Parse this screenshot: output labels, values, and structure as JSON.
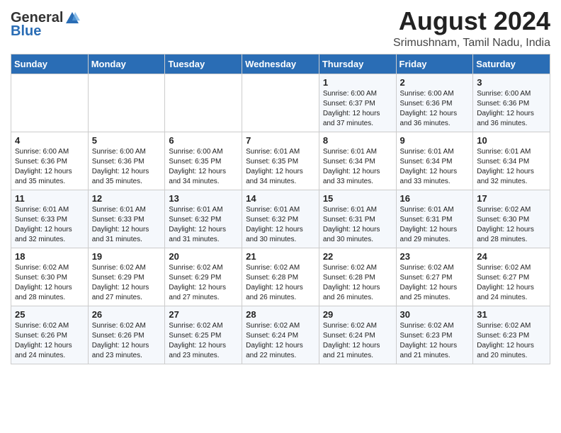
{
  "header": {
    "logo_general": "General",
    "logo_blue": "Blue",
    "month": "August 2024",
    "location": "Srimushnam, Tamil Nadu, India"
  },
  "weekdays": [
    "Sunday",
    "Monday",
    "Tuesday",
    "Wednesday",
    "Thursday",
    "Friday",
    "Saturday"
  ],
  "weeks": [
    [
      {
        "day": "",
        "info": ""
      },
      {
        "day": "",
        "info": ""
      },
      {
        "day": "",
        "info": ""
      },
      {
        "day": "",
        "info": ""
      },
      {
        "day": "1",
        "info": "Sunrise: 6:00 AM\nSunset: 6:37 PM\nDaylight: 12 hours\nand 37 minutes."
      },
      {
        "day": "2",
        "info": "Sunrise: 6:00 AM\nSunset: 6:36 PM\nDaylight: 12 hours\nand 36 minutes."
      },
      {
        "day": "3",
        "info": "Sunrise: 6:00 AM\nSunset: 6:36 PM\nDaylight: 12 hours\nand 36 minutes."
      }
    ],
    [
      {
        "day": "4",
        "info": "Sunrise: 6:00 AM\nSunset: 6:36 PM\nDaylight: 12 hours\nand 35 minutes."
      },
      {
        "day": "5",
        "info": "Sunrise: 6:00 AM\nSunset: 6:36 PM\nDaylight: 12 hours\nand 35 minutes."
      },
      {
        "day": "6",
        "info": "Sunrise: 6:00 AM\nSunset: 6:35 PM\nDaylight: 12 hours\nand 34 minutes."
      },
      {
        "day": "7",
        "info": "Sunrise: 6:01 AM\nSunset: 6:35 PM\nDaylight: 12 hours\nand 34 minutes."
      },
      {
        "day": "8",
        "info": "Sunrise: 6:01 AM\nSunset: 6:34 PM\nDaylight: 12 hours\nand 33 minutes."
      },
      {
        "day": "9",
        "info": "Sunrise: 6:01 AM\nSunset: 6:34 PM\nDaylight: 12 hours\nand 33 minutes."
      },
      {
        "day": "10",
        "info": "Sunrise: 6:01 AM\nSunset: 6:34 PM\nDaylight: 12 hours\nand 32 minutes."
      }
    ],
    [
      {
        "day": "11",
        "info": "Sunrise: 6:01 AM\nSunset: 6:33 PM\nDaylight: 12 hours\nand 32 minutes."
      },
      {
        "day": "12",
        "info": "Sunrise: 6:01 AM\nSunset: 6:33 PM\nDaylight: 12 hours\nand 31 minutes."
      },
      {
        "day": "13",
        "info": "Sunrise: 6:01 AM\nSunset: 6:32 PM\nDaylight: 12 hours\nand 31 minutes."
      },
      {
        "day": "14",
        "info": "Sunrise: 6:01 AM\nSunset: 6:32 PM\nDaylight: 12 hours\nand 30 minutes."
      },
      {
        "day": "15",
        "info": "Sunrise: 6:01 AM\nSunset: 6:31 PM\nDaylight: 12 hours\nand 30 minutes."
      },
      {
        "day": "16",
        "info": "Sunrise: 6:01 AM\nSunset: 6:31 PM\nDaylight: 12 hours\nand 29 minutes."
      },
      {
        "day": "17",
        "info": "Sunrise: 6:02 AM\nSunset: 6:30 PM\nDaylight: 12 hours\nand 28 minutes."
      }
    ],
    [
      {
        "day": "18",
        "info": "Sunrise: 6:02 AM\nSunset: 6:30 PM\nDaylight: 12 hours\nand 28 minutes."
      },
      {
        "day": "19",
        "info": "Sunrise: 6:02 AM\nSunset: 6:29 PM\nDaylight: 12 hours\nand 27 minutes."
      },
      {
        "day": "20",
        "info": "Sunrise: 6:02 AM\nSunset: 6:29 PM\nDaylight: 12 hours\nand 27 minutes."
      },
      {
        "day": "21",
        "info": "Sunrise: 6:02 AM\nSunset: 6:28 PM\nDaylight: 12 hours\nand 26 minutes."
      },
      {
        "day": "22",
        "info": "Sunrise: 6:02 AM\nSunset: 6:28 PM\nDaylight: 12 hours\nand 26 minutes."
      },
      {
        "day": "23",
        "info": "Sunrise: 6:02 AM\nSunset: 6:27 PM\nDaylight: 12 hours\nand 25 minutes."
      },
      {
        "day": "24",
        "info": "Sunrise: 6:02 AM\nSunset: 6:27 PM\nDaylight: 12 hours\nand 24 minutes."
      }
    ],
    [
      {
        "day": "25",
        "info": "Sunrise: 6:02 AM\nSunset: 6:26 PM\nDaylight: 12 hours\nand 24 minutes."
      },
      {
        "day": "26",
        "info": "Sunrise: 6:02 AM\nSunset: 6:26 PM\nDaylight: 12 hours\nand 23 minutes."
      },
      {
        "day": "27",
        "info": "Sunrise: 6:02 AM\nSunset: 6:25 PM\nDaylight: 12 hours\nand 23 minutes."
      },
      {
        "day": "28",
        "info": "Sunrise: 6:02 AM\nSunset: 6:24 PM\nDaylight: 12 hours\nand 22 minutes."
      },
      {
        "day": "29",
        "info": "Sunrise: 6:02 AM\nSunset: 6:24 PM\nDaylight: 12 hours\nand 21 minutes."
      },
      {
        "day": "30",
        "info": "Sunrise: 6:02 AM\nSunset: 6:23 PM\nDaylight: 12 hours\nand 21 minutes."
      },
      {
        "day": "31",
        "info": "Sunrise: 6:02 AM\nSunset: 6:23 PM\nDaylight: 12 hours\nand 20 minutes."
      }
    ]
  ]
}
